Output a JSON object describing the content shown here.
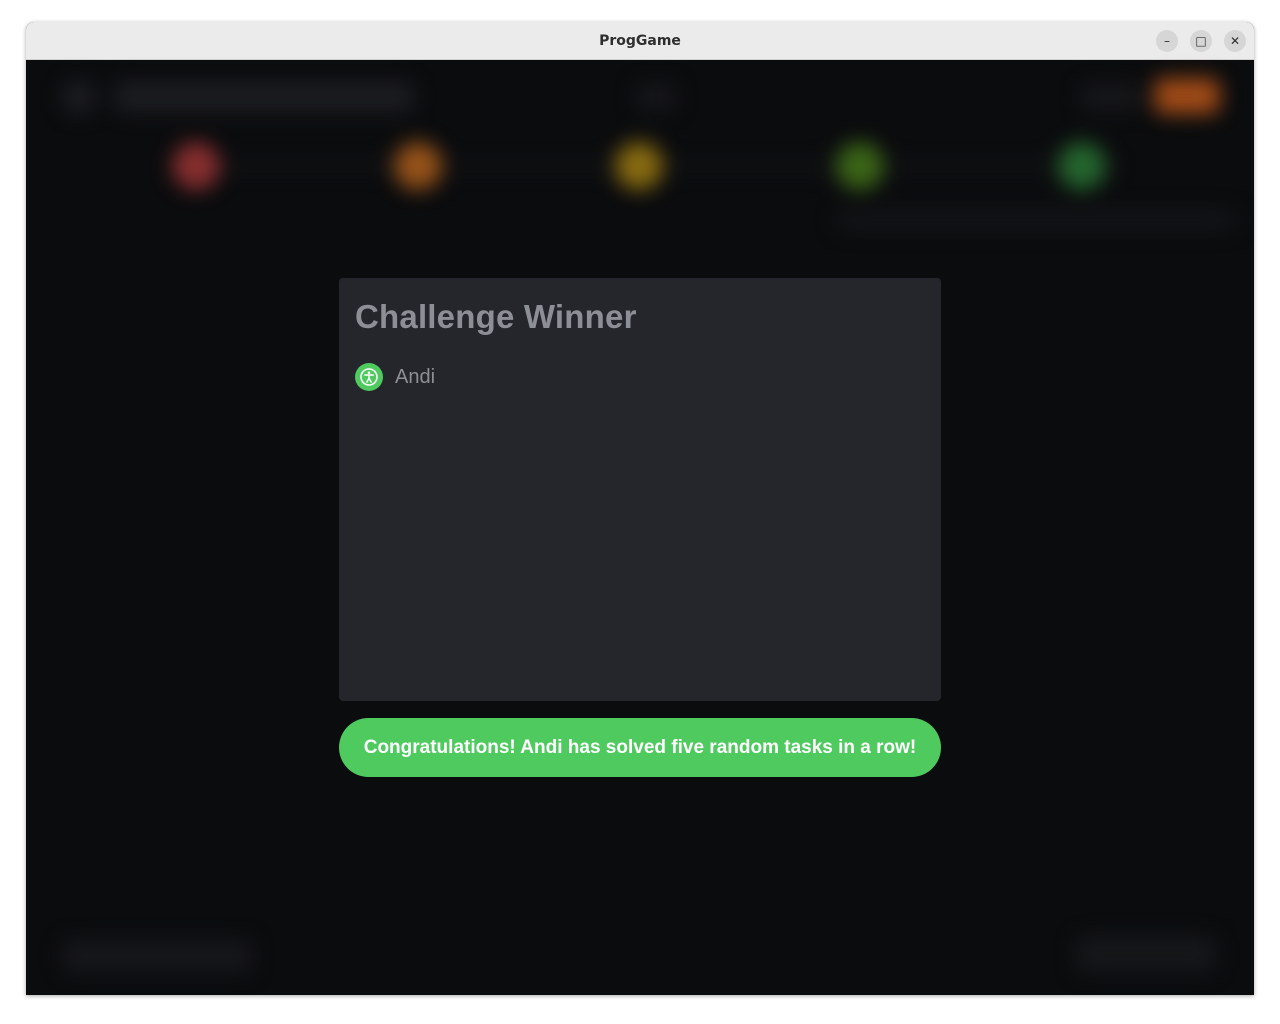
{
  "window": {
    "title": "ProgGame",
    "controls": {
      "minimize_glyph": "–",
      "maximize_glyph": "□",
      "close_glyph": "✕"
    }
  },
  "modal": {
    "title": "Challenge Winner",
    "winner": {
      "name": "Andi",
      "icon": "accessibility-icon"
    }
  },
  "banner": {
    "message": "Congratulations! Andi has solved five random tasks in a row!"
  },
  "colors": {
    "accent_green": "#4fca5f",
    "modal_bg": "#25262b",
    "app_bg": "#0b0c0e",
    "muted_text": "#8c8f96",
    "stage_red": "#b03a3a",
    "stage_orange": "#c46a1c",
    "stage_yellow": "#b08a10",
    "stage_lime": "#4f8a1a",
    "stage_green": "#2f8a3a",
    "header_action_orange": "#e0651a"
  }
}
